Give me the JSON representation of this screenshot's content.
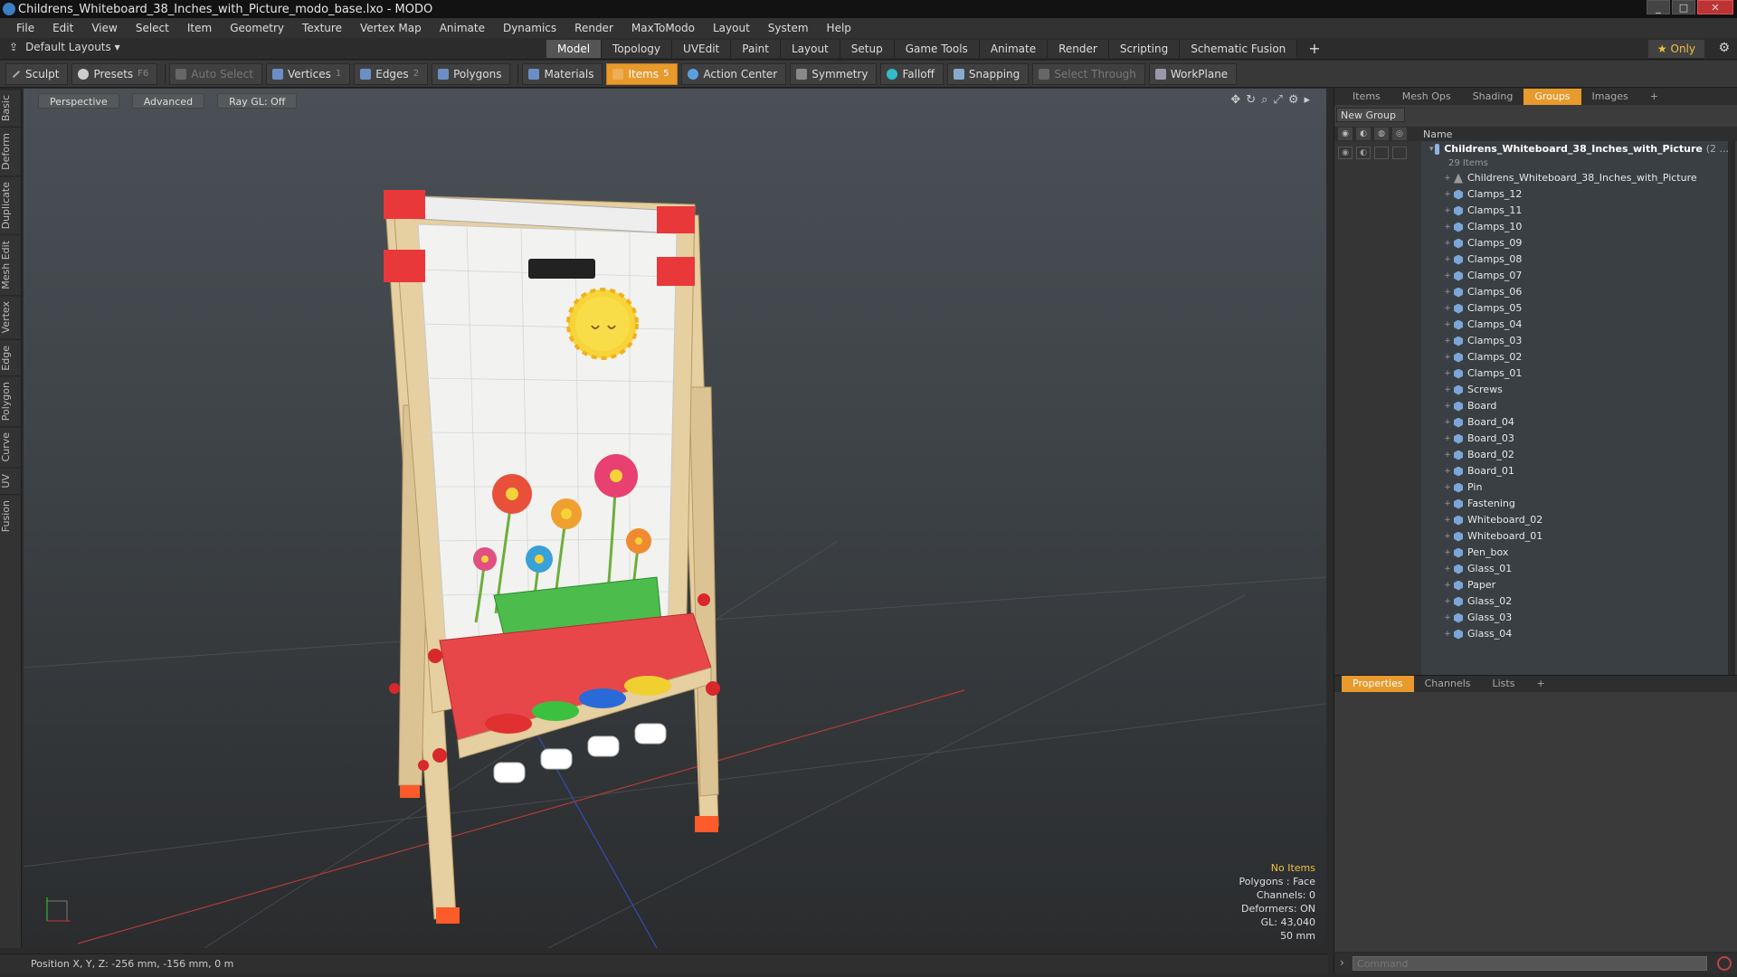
{
  "window": {
    "title": "Childrens_Whiteboard_38_Inches_with_Picture_modo_base.lxo - MODO"
  },
  "menu": [
    "File",
    "Edit",
    "View",
    "Select",
    "Item",
    "Geometry",
    "Texture",
    "Vertex Map",
    "Animate",
    "Dynamics",
    "Render",
    "MaxToModo",
    "Layout",
    "System",
    "Help"
  ],
  "layouts": {
    "default_label": "Default Layouts",
    "tabs": [
      "Model",
      "Topology",
      "UVEdit",
      "Paint",
      "Layout",
      "Setup",
      "Game Tools",
      "Animate",
      "Render",
      "Scripting",
      "Schematic Fusion"
    ],
    "active": "Model",
    "only_label": "Only"
  },
  "toolbar": {
    "sculpt": "Sculpt",
    "presets": "Presets",
    "presets_key": "F6",
    "auto_select": "Auto Select",
    "vertices": "Vertices",
    "vertices_key": "1",
    "edges": "Edges",
    "edges_key": "2",
    "polygons": "Polygons",
    "materials": "Materials",
    "items": "Items",
    "items_key": "5",
    "action_center": "Action Center",
    "symmetry": "Symmetry",
    "falloff": "Falloff",
    "snapping": "Snapping",
    "select_through": "Select Through",
    "workplane": "WorkPlane"
  },
  "left_tabs": [
    "Basic",
    "Deform",
    "Duplicate",
    "Mesh Edit",
    "Vertex",
    "Edge",
    "Polygon",
    "Curve",
    "UV",
    "Fusion"
  ],
  "viewport": {
    "view": "Perspective",
    "shading": "Advanced",
    "raygl": "Ray GL: Off"
  },
  "hud": {
    "no_items": "No Items",
    "polygons": "Polygons : Face",
    "channels": "Channels: 0",
    "deformers": "Deformers: ON",
    "gl": "GL: 43,040",
    "scale": "50 mm"
  },
  "status": {
    "position": "Position X, Y, Z:  -256 mm, -156 mm, 0 m"
  },
  "right_tabs": [
    "Items",
    "Mesh Ops",
    "Shading",
    "Groups",
    "Images"
  ],
  "right_active": "Groups",
  "new_group": "New Group",
  "tree": {
    "column_name": "Name",
    "group_name": "Childrens_Whiteboard_38_Inches_with_Picture",
    "group_suffix": "(2 ...",
    "count": "29 Items",
    "items": [
      "Childrens_Whiteboard_38_Inches_with_Picture",
      "Clamps_12",
      "Clamps_11",
      "Clamps_10",
      "Clamps_09",
      "Clamps_08",
      "Clamps_07",
      "Clamps_06",
      "Clamps_05",
      "Clamps_04",
      "Clamps_03",
      "Clamps_02",
      "Clamps_01",
      "Screws",
      "Board",
      "Board_04",
      "Board_03",
      "Board_02",
      "Board_01",
      "Pin",
      "Fastening",
      "Whiteboard_02",
      "Whiteboard_01",
      "Pen_box",
      "Glass_01",
      "Paper",
      "Glass_02",
      "Glass_03",
      "Glass_04"
    ]
  },
  "bottom_tabs": [
    "Properties",
    "Channels",
    "Lists"
  ],
  "bottom_active": "Properties",
  "command": {
    "placeholder": "Command"
  },
  "colors": {
    "accent": "#e89a2c",
    "board_red": "#e8383a",
    "wood": "#e6cfa0"
  }
}
